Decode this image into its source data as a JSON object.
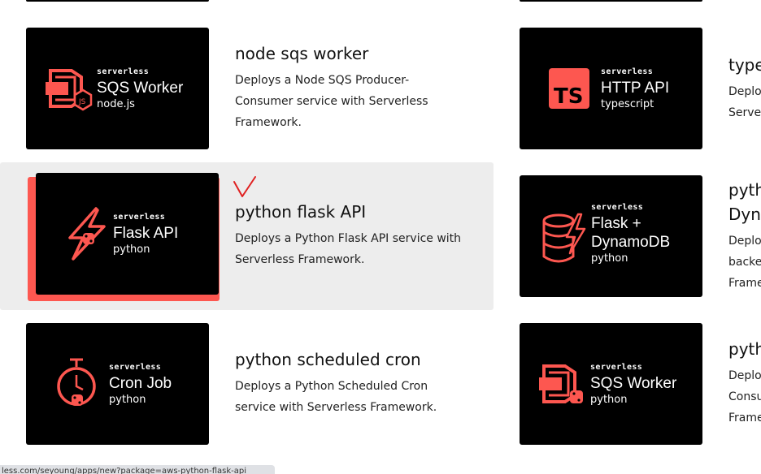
{
  "brand_word": "serverless",
  "accent_color": "#fd5750",
  "cards": {
    "sqs_node": {
      "name": "SQS Worker",
      "lang": "node.js",
      "title": "node sqs worker",
      "description": "Deploys a Node SQS Producer-Consumer service with Serverless Framework."
    },
    "http_ts": {
      "name": "HTTP API",
      "lang": "typescript",
      "title": "type",
      "description": "Deplo Serve"
    },
    "flask_api": {
      "name": "Flask API",
      "lang": "python",
      "title": "python flask API",
      "description": "Deploys a Python Flask API service with Serverless Framework."
    },
    "flask_dynamo": {
      "name_line1": "Flask +",
      "name_line2": "DynamoDB",
      "lang": "python",
      "title_line1": "pyth",
      "title_line2": "Dyn",
      "description": "Deplo backe Frame"
    },
    "cron_py": {
      "name": "Cron Job",
      "lang": "python",
      "title": "python scheduled cron",
      "description": "Deploys a Python Scheduled Cron service with Serverless Framework."
    },
    "sqs_py": {
      "name": "SQS Worker",
      "lang": "python",
      "title": "pyth",
      "description": "Deplo Consu Frame"
    }
  },
  "status_url": "less.com/seyoung/apps/new?package=aws-python-flask-api"
}
